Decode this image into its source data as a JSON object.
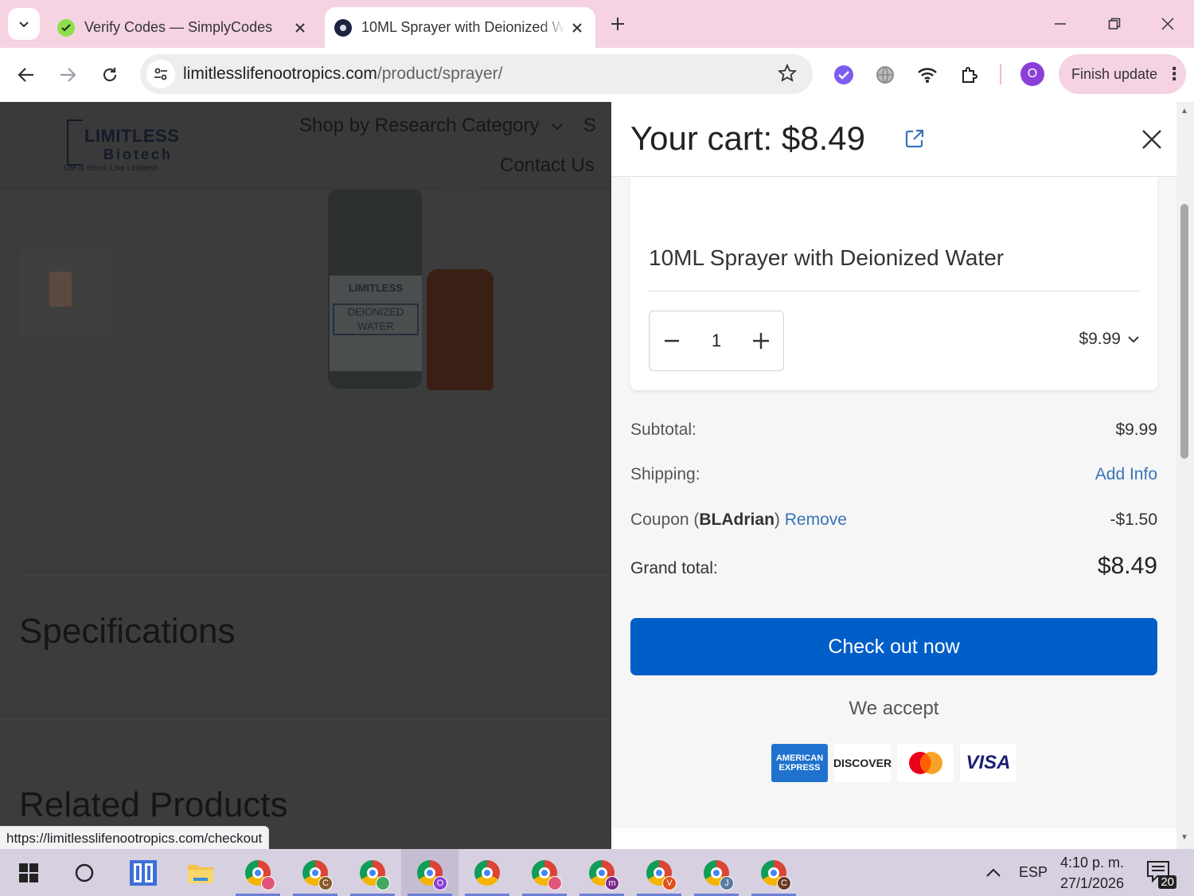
{
  "browser": {
    "tabs": [
      {
        "title": "Verify Codes — SimplyCodes",
        "active": false,
        "favicon": "simplycodes-icon"
      },
      {
        "title": "10ML Sprayer with Deionized W",
        "active": true,
        "favicon": "limitless-icon"
      }
    ],
    "url_host": "limitlesslifenootropics.com",
    "url_path": "/product/sprayer/",
    "profile_initial": "O",
    "finish_update_label": "Finish update",
    "status_url": "https://limitlesslifenootropics.com/checkout"
  },
  "site": {
    "logo_line1": "LIMITLESS",
    "logo_line2": "Biotech",
    "logo_tagline": "Life is Short. Live Limitless.",
    "nav_research": "Shop by Research Category",
    "nav_contact": "Contact Us",
    "vial_brand": "LIMITLESS",
    "vial_label": "DEIONIZED WATER",
    "specifications_heading": "Specifications",
    "related_heading": "Related Products"
  },
  "cart": {
    "title": "Your cart: $8.49",
    "item": {
      "name": "10ML Sprayer with Deionized Water",
      "quantity": "1",
      "price": "$9.99"
    },
    "subtotal_label": "Subtotal:",
    "subtotal_value": "$9.99",
    "shipping_label": "Shipping:",
    "shipping_value": "Add Info",
    "coupon_prefix": "Coupon (",
    "coupon_code": "BLAdrian",
    "coupon_suffix": ")",
    "coupon_remove": "Remove",
    "coupon_value": "-$1.50",
    "grand_total_label": "Grand total:",
    "grand_total_value": "$8.49",
    "checkout_label": "Check out now",
    "we_accept": "We accept",
    "cards": [
      "AMERICAN EXPRESS",
      "DISCOVER",
      "mastercard",
      "VISA"
    ]
  },
  "taskbar": {
    "apps": [
      {
        "name": "start-icon"
      },
      {
        "name": "search-icon"
      },
      {
        "name": "task-view-icon"
      },
      {
        "name": "file-explorer-icon"
      },
      {
        "name": "chrome-icon",
        "badge": "",
        "badge_color": "#e2557a"
      },
      {
        "name": "chrome-icon",
        "badge": "C",
        "badge_color": "#8a5a2c"
      },
      {
        "name": "chrome-icon",
        "badge": "",
        "badge_color": "#41a85f"
      },
      {
        "name": "chrome-icon",
        "badge": "O",
        "badge_color": "#8b3fd9"
      },
      {
        "name": "chrome-icon",
        "badge": "",
        "badge_color": ""
      },
      {
        "name": "chrome-icon",
        "badge": "",
        "badge_color": "#e2557a"
      },
      {
        "name": "chrome-icon",
        "badge": "m",
        "badge_color": "#7b2a8c"
      },
      {
        "name": "chrome-icon",
        "badge": "V",
        "badge_color": "#e2501e"
      },
      {
        "name": "chrome-icon",
        "badge": "J",
        "badge_color": "#5a7aa0"
      },
      {
        "name": "chrome-icon",
        "badge": "C",
        "badge_color": "#6a3a22"
      }
    ],
    "language": "ESP",
    "time": "4:10 p. m.",
    "date": "27/1/2026",
    "notifications": "20"
  },
  "colors": {
    "tabstrip": "#f5d3e3",
    "checkout_button": "#005ec8",
    "link": "#3a73b8",
    "overlay_page": "#3c3c3c"
  }
}
